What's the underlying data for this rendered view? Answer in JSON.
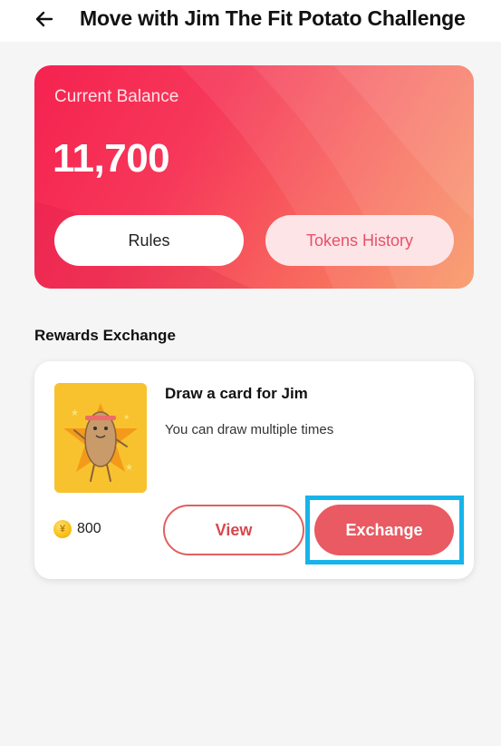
{
  "header": {
    "title": "Move with Jim The Fit Potato Challenge",
    "back_icon": "arrow-left-icon"
  },
  "balance": {
    "label": "Current Balance",
    "value": "11,700",
    "rules_label": "Rules",
    "history_label": "Tokens History"
  },
  "rewards": {
    "section_title": "Rewards Exchange",
    "items": [
      {
        "name": "Draw a card for Jim",
        "description": "You can draw multiple times",
        "cost": "800",
        "cost_icon": "coin-icon",
        "image_icon": "potato-character-icon",
        "view_label": "View",
        "exchange_label": "Exchange"
      }
    ]
  },
  "colors": {
    "accent": "#e95a62",
    "card_gradient_start": "#f5224f",
    "card_gradient_end": "#f8935f",
    "highlight": "#17b4ea",
    "thumb_bg": "#f8c22f"
  }
}
